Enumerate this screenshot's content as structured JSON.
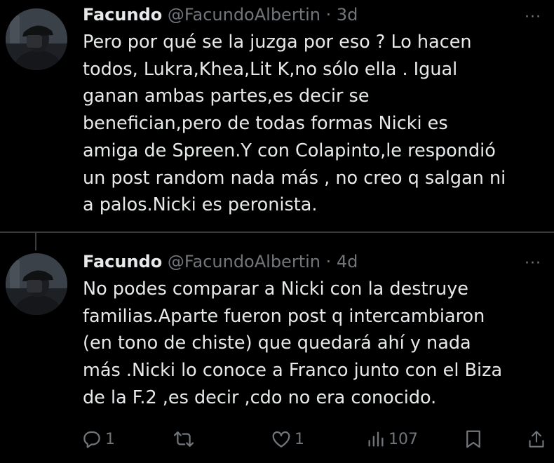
{
  "tweets": [
    {
      "name": "Facundo",
      "handle": "@FacundoAlbertin",
      "separator": "·",
      "time": "3d",
      "more": "···",
      "lines": [
        "Pero por qué se la juzga por eso ? Lo hacen",
        "todos, Lukra,Khea,Lit K,no sólo ella . Igual",
        "ganan ambas partes,es decir se",
        "benefician,pero de todas formas Nicki es",
        "amiga de Spreen.Y con Colapinto,le respondió",
        "un post random nada más , no creo q salgan ni",
        "a palos.Nicki es peronista."
      ]
    },
    {
      "name": "Facundo",
      "handle": "@FacundoAlbertin",
      "separator": "·",
      "time": "4d",
      "more": "···",
      "lines": [
        "No podes comparar a Nicki con la destruye",
        "familias.Aparte fueron post q intercambiaron",
        "(en tono de chiste) que quedará ahí y nada",
        "más .Nicki lo conoce a Franco junto con el Biza",
        "de la F.2 ,es decir ,cdo no era conocido."
      ],
      "actions": {
        "replies": "1",
        "retweets": "",
        "likes": "1",
        "views": "107"
      }
    }
  ],
  "colors": {
    "background": "#000000",
    "text": "#e7e9ea",
    "secondary": "#71767b",
    "divider": "#3a3d40"
  },
  "icons": [
    "reply-icon",
    "retweet-icon",
    "like-icon",
    "views-icon",
    "bookmark-icon",
    "share-icon",
    "more-icon"
  ]
}
